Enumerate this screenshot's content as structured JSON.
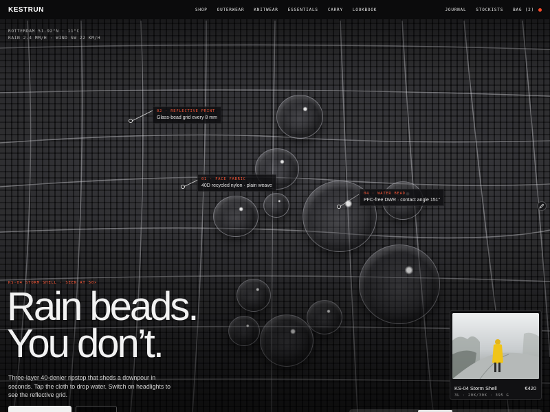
{
  "nav": {
    "logo": "KESTRUN",
    "center_links": [
      "SHOP",
      "OUTERWEAR",
      "KNITWEAR",
      "ESSENTIALS",
      "CARRY",
      "LOOKBOOK"
    ],
    "right_links": [
      "JOURNAL",
      "STOCKISTS",
      "BAG (2)"
    ]
  },
  "weather": {
    "line1": "ROTTERDAM 51.92°N · 11°C",
    "line2": "RAIN 2.4 MM/H · WIND SW 22 KM/H"
  },
  "callouts": [
    {
      "tag": "02 · REFLECTIVE PRINT",
      "desc": "Glass-bead grid every 8 mm"
    },
    {
      "tag": "01 · FACE FABRIC",
      "desc": "40D recycled nylon · plain weave"
    },
    {
      "tag": "04 · WATER BEAD",
      "desc": "PFC-free DWR · contact angle 151°"
    }
  ],
  "hero": {
    "eyebrow": "KS-04 STORM SHELL · SEEN AT 50×",
    "headline_1": "Rain beads.",
    "headline_2": "You don’t.",
    "subcopy": "Three-layer 40-denier ripstop that sheds a downpour in seconds. Tap the cloth to drop water. Switch on headlights to see the reflective grid."
  },
  "product": {
    "name": "KS-04 Storm Shell",
    "price": "€420",
    "spec": "3L · 20K/30K · 395 G"
  },
  "colors": {
    "accent": "#ff5a3a",
    "background": "#0d0d0f",
    "jacket": "#f0c419"
  },
  "icons": {
    "edit": "pencil-icon"
  }
}
